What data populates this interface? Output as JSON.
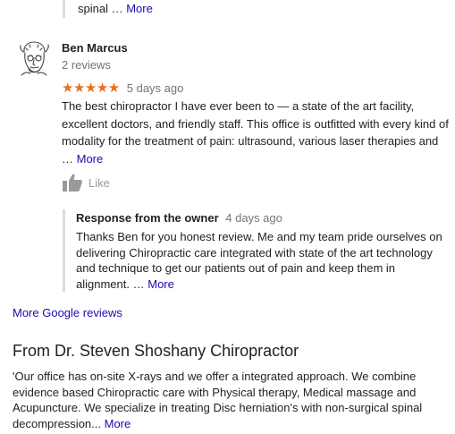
{
  "previous_owner_response": {
    "text": "spinal",
    "more_label": "More"
  },
  "review": {
    "reviewer_name": "Ben Marcus",
    "reviewer_review_count": "2 reviews",
    "stars": "★★★★★",
    "rating": 5,
    "date": "5 days ago",
    "text": "The best chiropractor I have ever been to — a state of the art facility, excellent doctors, and friendly staff. This office is outfitted with every kind of modality for the treatment of pain: ultrasound, various laser therapies and",
    "ellipsis": "…",
    "more_label": "More",
    "like_label": "Like",
    "avatar_icon": "sketch-avatar-icon",
    "like_icon": "thumbs-up-icon"
  },
  "owner_response": {
    "title": "Response from the owner",
    "date": "4 days ago",
    "text": "Thanks Ben for you honest review. Me and my team pride ourselves on delivering Chiropractic care integrated with state of the art technology and technique to get our patients out of pain and keep them in alignment.",
    "ellipsis": "…",
    "more_label": "More"
  },
  "more_google_reviews_label": "More Google reviews",
  "from_business": {
    "title": "From Dr. Steven Shoshany Chiropractor",
    "text": "'Our office has on-site X-rays and we offer a integrated approach. We combine evidence based Chiropractic care with Physical therapy, Medical massage and Acupuncture. We specialize in treating Disc herniation's with non-surgical spinal decompression...",
    "more_label": "More"
  },
  "colors": {
    "link": "#1a0dab",
    "star": "#e7711b",
    "muted": "#70757a",
    "divider": "#dadce0"
  }
}
